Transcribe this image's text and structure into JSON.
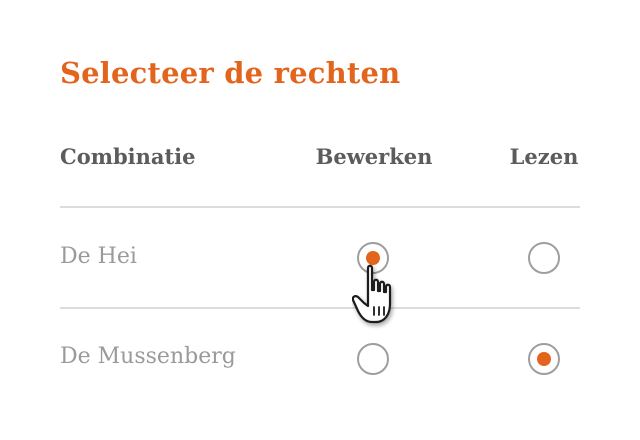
{
  "title": "Selecteer de rechten",
  "columns": {
    "combination": "Combinatie",
    "edit": "Bewerken",
    "read": "Lezen"
  },
  "rows": [
    {
      "name": "De Hei",
      "edit_selected": true,
      "read_selected": false
    },
    {
      "name": "De Mussenberg",
      "edit_selected": false,
      "read_selected": true
    }
  ],
  "colors": {
    "accent": "#e2641d",
    "header_text": "#5c5c5c",
    "row_text": "#9a9a9a",
    "divider": "#dcdcdc",
    "radio_border": "#9e9e9e"
  },
  "cursor_icon": "hand-pointer-icon"
}
